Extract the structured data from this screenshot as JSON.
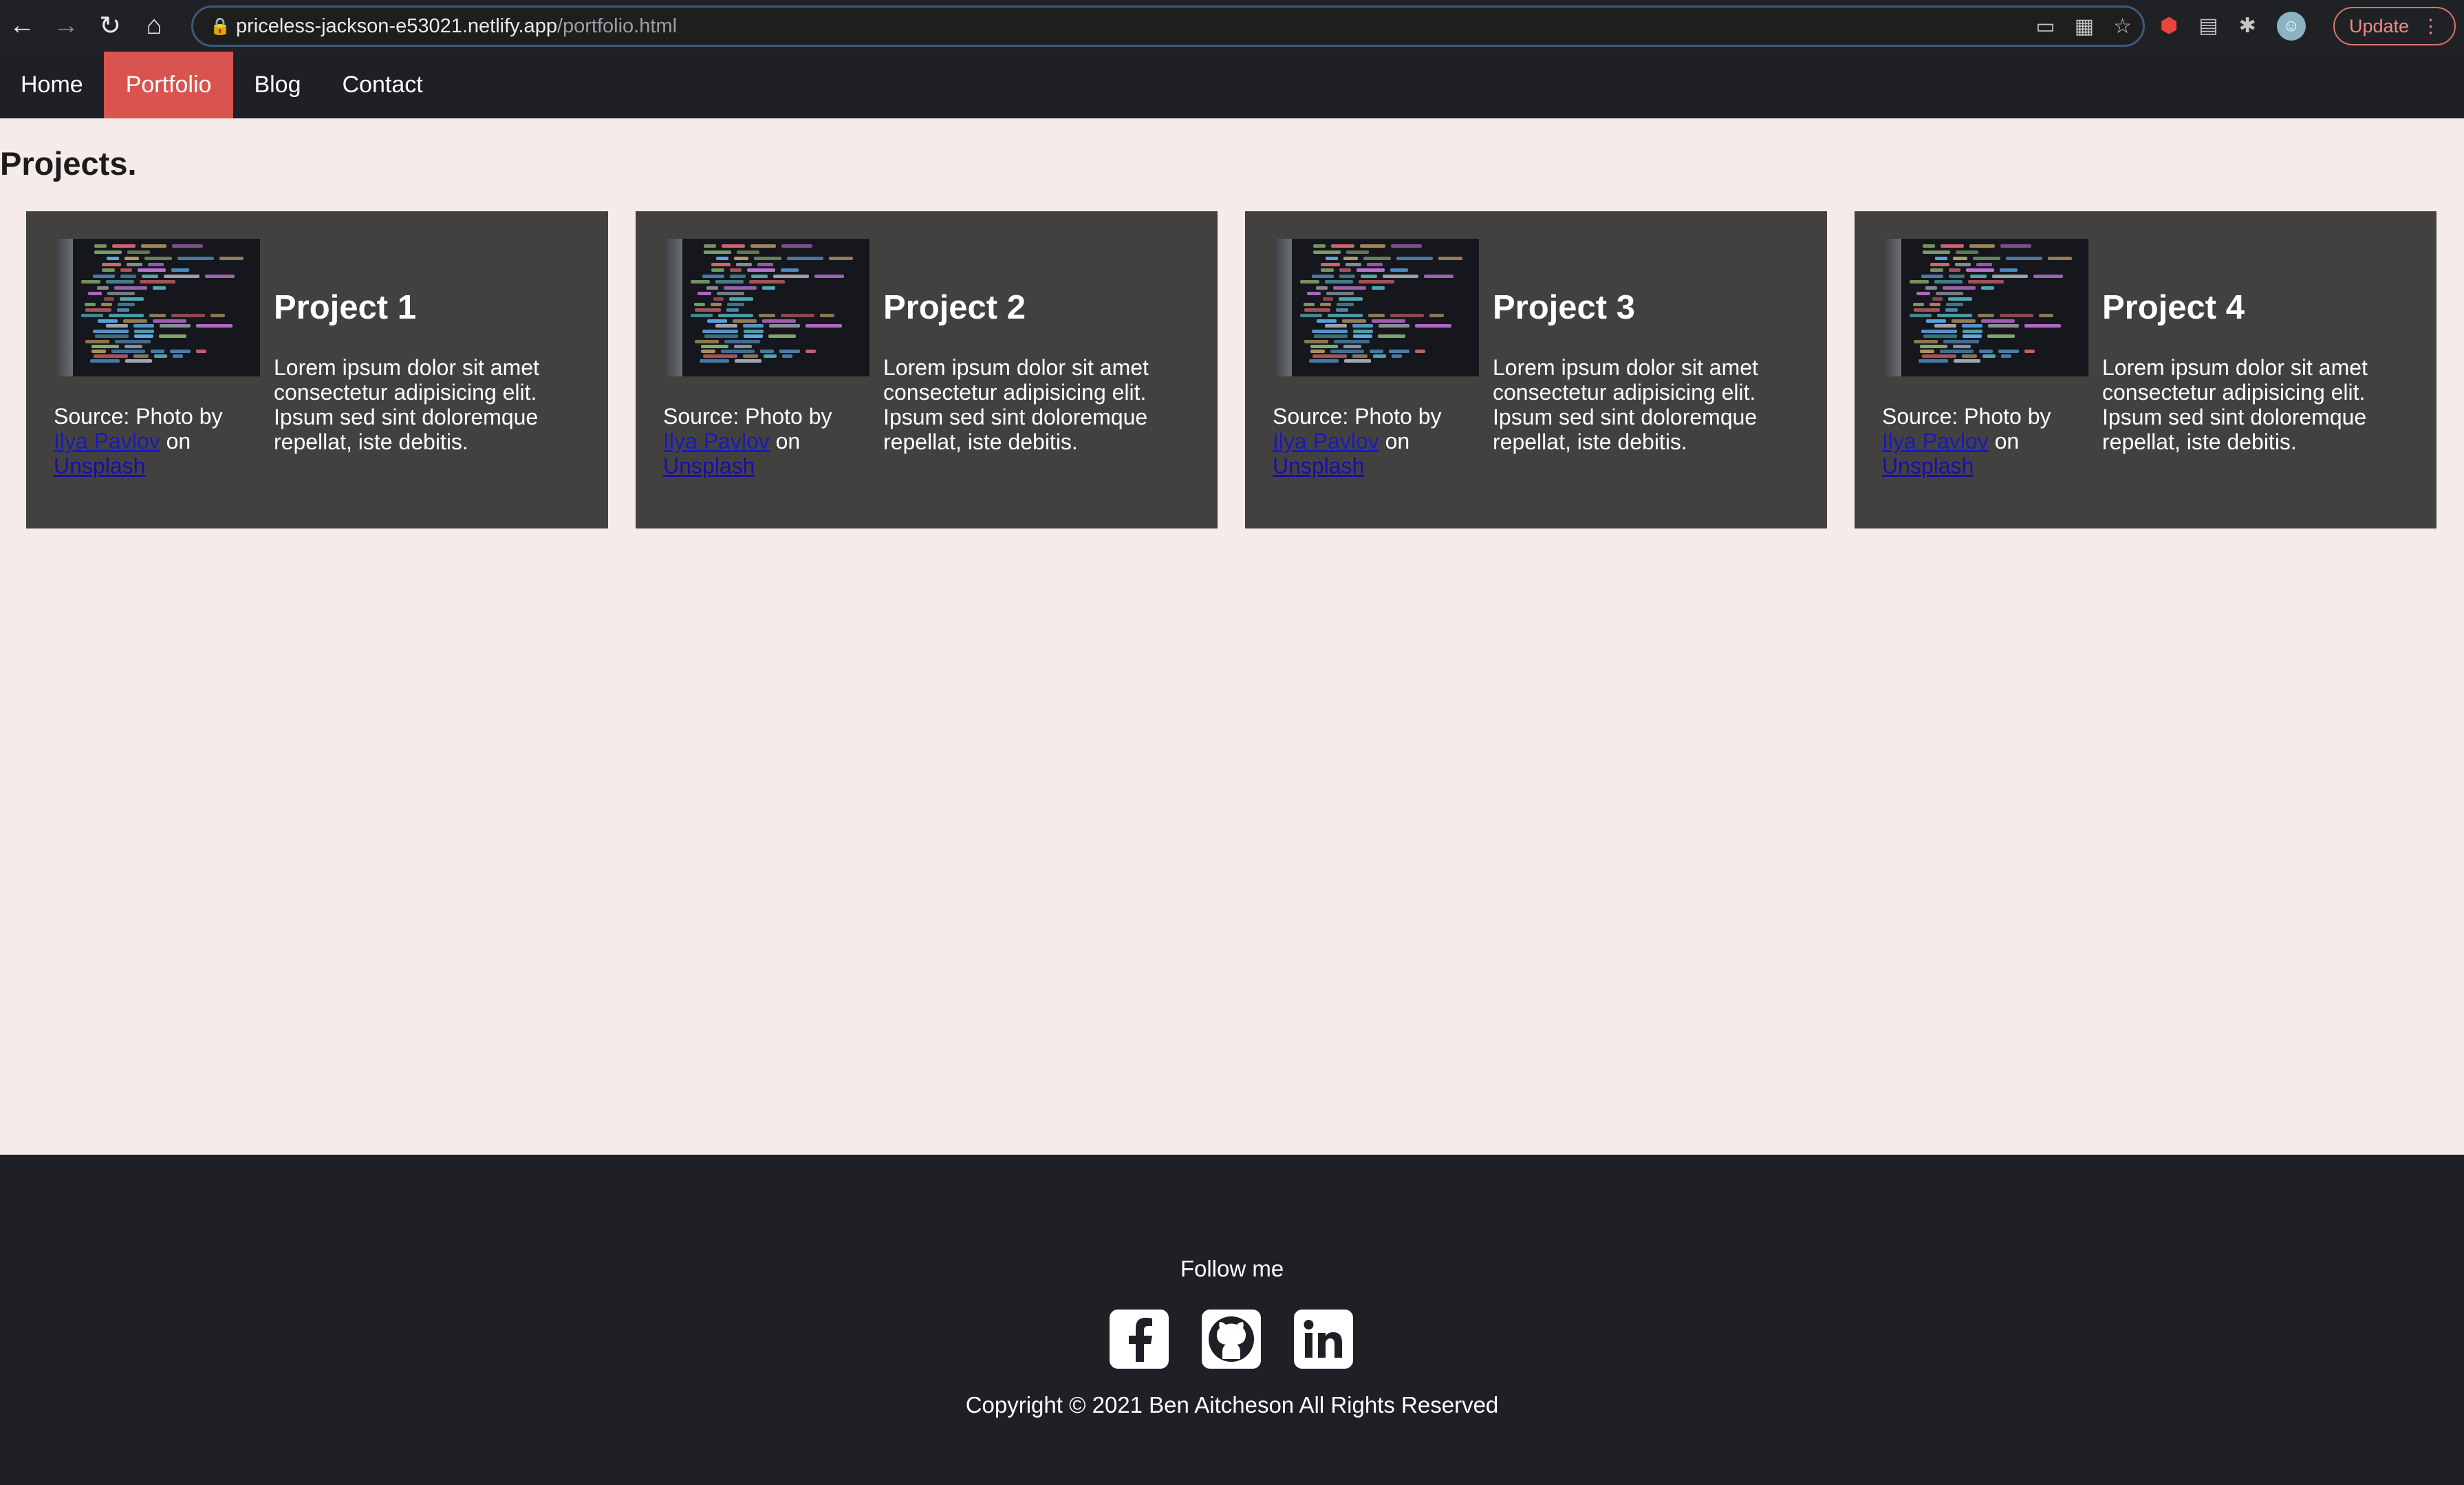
{
  "browser": {
    "url_host": "priceless-jackson-e53021.netlify.app",
    "url_path": "/portfolio.html",
    "update_label": "Update",
    "icons": [
      "back-icon",
      "forward-icon",
      "reload-icon",
      "home-icon",
      "lock-icon",
      "cast-icon",
      "qr-icon",
      "star-icon",
      "extension-icon",
      "puzzle-icon",
      "profile-avatar",
      "menu-icon"
    ]
  },
  "nav": {
    "items": [
      {
        "label": "Home",
        "active": false
      },
      {
        "label": "Portfolio",
        "active": true
      },
      {
        "label": "Blog",
        "active": false
      },
      {
        "label": "Contact",
        "active": false
      }
    ]
  },
  "page": {
    "title": "Projects."
  },
  "projects": [
    {
      "title": "Project 1",
      "description": "Lorem ipsum dolor sit amet consectetur adipisicing elit. Ipsum sed sint doloremque repellat, iste debitis.",
      "source_prefix": "Source: Photo by",
      "author": "Ilya Pavlov",
      "on": "on",
      "site": "Unsplash"
    },
    {
      "title": "Project 2",
      "description": "Lorem ipsum dolor sit amet consectetur adipisicing elit. Ipsum sed sint doloremque repellat, iste debitis.",
      "source_prefix": "Source: Photo by",
      "author": "Ilya Pavlov",
      "on": "on",
      "site": "Unsplash"
    },
    {
      "title": "Project 3",
      "description": "Lorem ipsum dolor sit amet consectetur adipisicing elit. Ipsum sed sint doloremque repellat, iste debitis.",
      "source_prefix": "Source: Photo by",
      "author": "Ilya Pavlov",
      "on": "on",
      "site": "Unsplash"
    },
    {
      "title": "Project 4",
      "description": "Lorem ipsum dolor sit amet consectetur adipisicing elit. Ipsum sed sint doloremque repellat, iste debitis.",
      "source_prefix": "Source: Photo by",
      "author": "Ilya Pavlov",
      "on": "on",
      "site": "Unsplash"
    }
  ],
  "footer": {
    "follow": "Follow me",
    "social": [
      "facebook-icon",
      "github-icon",
      "linkedin-icon"
    ],
    "copyright": "Copyright © 2021 Ben Aitcheson All Rights Reserved"
  },
  "colors": {
    "page_bg": "#f5ebe8",
    "nav_bg": "#1f1f26",
    "active_nav": "#d9534f",
    "card_bg": "#434140",
    "link": "#1a0dab"
  }
}
